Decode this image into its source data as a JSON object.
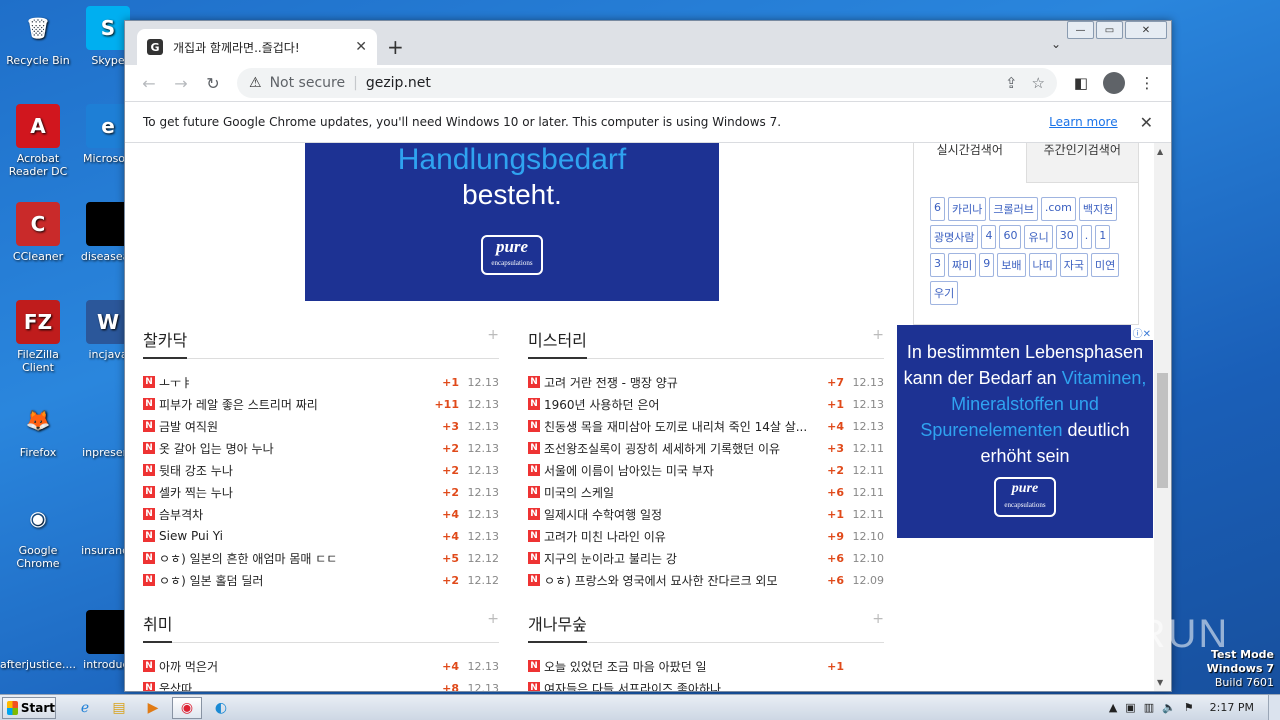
{
  "desktop": {
    "icons": [
      {
        "label": "Recycle Bin",
        "glyph": "🗑",
        "bg": "transparent"
      },
      {
        "label": "Skype",
        "glyph": "S",
        "bg": "#00aff0"
      },
      {
        "label": "Acrobat Reader DC",
        "glyph": "A",
        "bg": "#d1161e"
      },
      {
        "label": "Microsoft",
        "glyph": "e",
        "bg": "#1e7fd6"
      },
      {
        "label": "CCleaner",
        "glyph": "C",
        "bg": "#c92a2a"
      },
      {
        "label": "diseaseas",
        "glyph": "",
        "bg": "#000"
      },
      {
        "label": "FileZilla Client",
        "glyph": "FZ",
        "bg": "#bf1c1c"
      },
      {
        "label": "incjava",
        "glyph": "W",
        "bg": "#2b579a"
      },
      {
        "label": "Firefox",
        "glyph": "🦊",
        "bg": "transparent"
      },
      {
        "label": "inpresent",
        "glyph": "",
        "bg": "transparent"
      },
      {
        "label": "Google Chrome",
        "glyph": "◉",
        "bg": "transparent"
      },
      {
        "label": "insurance",
        "glyph": "",
        "bg": "transparent"
      },
      {
        "label": "afterjustice....",
        "glyph": "",
        "bg": "transparent"
      },
      {
        "label": "introduct",
        "glyph": "",
        "bg": "#000"
      }
    ]
  },
  "browser": {
    "tab_title": "개집과 함께라면..즐겁다!",
    "favicon": "G",
    "address": {
      "security": "Not secure",
      "url": "gezip.net"
    },
    "infobar": {
      "message": "To get future Google Chrome updates, you'll need Windows 10 or later. This computer is using Windows 7.",
      "link": "Learn more"
    }
  },
  "page": {
    "ad_top": {
      "line1": "Handlungsbedarf",
      "line2": "besteht.",
      "brand": "pure",
      "brand_sub": "encapsulations"
    },
    "side": {
      "tab_active": "실시간검색어",
      "tab_inactive": "주간인기검색어",
      "keywords": [
        "6",
        "카리나",
        "크롤러브",
        ".com",
        "백지헌",
        "광명사람",
        "4",
        "60",
        "유니",
        "30",
        ".",
        "1",
        "3",
        "짜미",
        "9",
        "보배",
        "나띠",
        "자국",
        "미연",
        "우기"
      ]
    },
    "ad_side": {
      "text1": "In bestimmten Lebensphasen kann der Bedarf an",
      "highlight": "Vitaminen, Mineralstoffen und Spurenelementen",
      "text2": "deutlich erhöht sein",
      "brand": "pure",
      "brand_sub": "encapsulations"
    },
    "boards": [
      {
        "title": "찰카닥",
        "items": [
          {
            "t": "ㅗㅜㅑ",
            "c": "+1",
            "d": "12.13"
          },
          {
            "t": "피부가 레알 좋은 스트리머 짜리",
            "c": "+11",
            "d": "12.13"
          },
          {
            "t": "금발 여직원",
            "c": "+3",
            "d": "12.13"
          },
          {
            "t": "옷 갈아 입는 명아 누나",
            "c": "+2",
            "d": "12.13"
          },
          {
            "t": "뒷태 강조 누나",
            "c": "+2",
            "d": "12.13"
          },
          {
            "t": "셀카 찍는 누나",
            "c": "+2",
            "d": "12.13"
          },
          {
            "t": "슴부격차",
            "c": "+4",
            "d": "12.13"
          },
          {
            "t": "Siew Pui Yi",
            "c": "+4",
            "d": "12.13"
          },
          {
            "t": "ㅇㅎ) 일본의 흔한 애엄마 몸매 ㄷㄷ",
            "c": "+5",
            "d": "12.12"
          },
          {
            "t": "ㅇㅎ) 일본 홀덤 딜러",
            "c": "+2",
            "d": "12.12"
          }
        ]
      },
      {
        "title": "미스터리",
        "items": [
          {
            "t": "고려 거란 전쟁 - 맹장 양규",
            "c": "+7",
            "d": "12.13"
          },
          {
            "t": "1960년 사용하던 은어",
            "c": "+1",
            "d": "12.13"
          },
          {
            "t": "친동생 목을 재미삼아 도끼로 내리쳐 죽인 14살 살...",
            "c": "+4",
            "d": "12.13"
          },
          {
            "t": "조선왕조실록이 굉장히 세세하게 기록했던 이유",
            "c": "+3",
            "d": "12.11"
          },
          {
            "t": "서울에 이름이 남아있는 미국 부자",
            "c": "+2",
            "d": "12.11"
          },
          {
            "t": "미국의 스케일",
            "c": "+6",
            "d": "12.11"
          },
          {
            "t": "일제시대 수학여행 일정",
            "c": "+1",
            "d": "12.11"
          },
          {
            "t": "고려가 미친 나라인 이유",
            "c": "+9",
            "d": "12.10"
          },
          {
            "t": "지구의 눈이라고 불리는 강",
            "c": "+6",
            "d": "12.10"
          },
          {
            "t": "ㅇㅎ) 프랑스와 영국에서 묘사한 잔다르크 외모",
            "c": "+6",
            "d": "12.09"
          }
        ]
      },
      {
        "title": "취미",
        "items": [
          {
            "t": "아까 먹은거",
            "c": "+4",
            "d": "12.13"
          },
          {
            "t": "웃샀따",
            "c": "+8",
            "d": "12.13"
          }
        ]
      },
      {
        "title": "개나무숲",
        "items": [
          {
            "t": "오늘 있었던 조금 마음 아팠던 일",
            "c": "+1",
            "d": ""
          },
          {
            "t": "여자들은 다들 서프라이즈 좋아하나",
            "c": "",
            "d": ""
          }
        ]
      }
    ]
  },
  "taskbar": {
    "start": "Start",
    "clock": "2:17 PM"
  },
  "watermark": "ANY RUN",
  "testmode": {
    "line1": "Test Mode",
    "line2": "Windows 7",
    "line3": "Build 7601"
  }
}
